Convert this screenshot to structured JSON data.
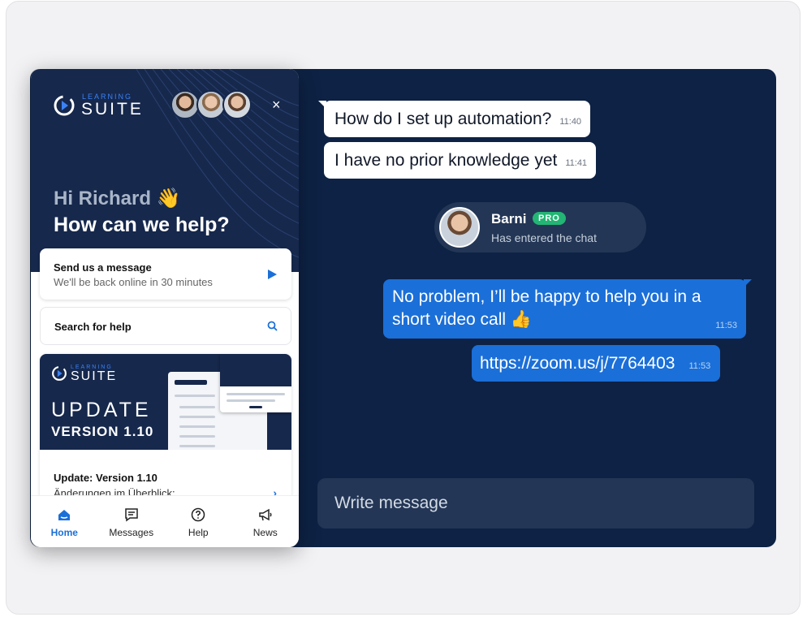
{
  "chat": {
    "messages_in": [
      {
        "text": "How do I set up automation?",
        "time": "11:40"
      },
      {
        "text": "I have no prior knowledge yet",
        "time": "11:41"
      }
    ],
    "agent": {
      "name": "Barni",
      "badge": "PRO",
      "status": "Has entered the chat"
    },
    "messages_out": [
      {
        "line1": "No problem, I’ll be happy to help you in a",
        "line2": "short video call 👍",
        "time": "11:53"
      },
      {
        "text": "https://zoom.us/j/7764403",
        "time": "11:53"
      }
    ],
    "input": {
      "placeholder": "Write message"
    }
  },
  "widget": {
    "logo": {
      "small": "LEARNING",
      "big": "SUITE"
    },
    "close_icon": "×",
    "greeting": "Hi Richard 👋",
    "help_title": "How can we help?",
    "message_card": {
      "title": "Send us a message",
      "subtitle": "We'll be back online in 30 minutes"
    },
    "search_card": {
      "title": "Search for help"
    },
    "update_card": {
      "image": {
        "logo_small": "LEARNING",
        "logo_big": "SUITE",
        "word": "UPDATE",
        "version": "VERSION 1.10"
      },
      "title": "Update: Version 1.10",
      "subtitle": "Änderungen im Überblick:"
    },
    "nav": [
      {
        "label": "Home",
        "icon": "home-icon",
        "active": true
      },
      {
        "label": "Messages",
        "icon": "messages-icon",
        "active": false
      },
      {
        "label": "Help",
        "icon": "help-icon",
        "active": false
      },
      {
        "label": "News",
        "icon": "megaphone-icon",
        "active": false
      }
    ]
  },
  "colors": {
    "chat_background": "#0d2244",
    "widget_header": "#16284c",
    "accent_blue": "#1b6fd8",
    "pro_badge": "#22b573"
  }
}
